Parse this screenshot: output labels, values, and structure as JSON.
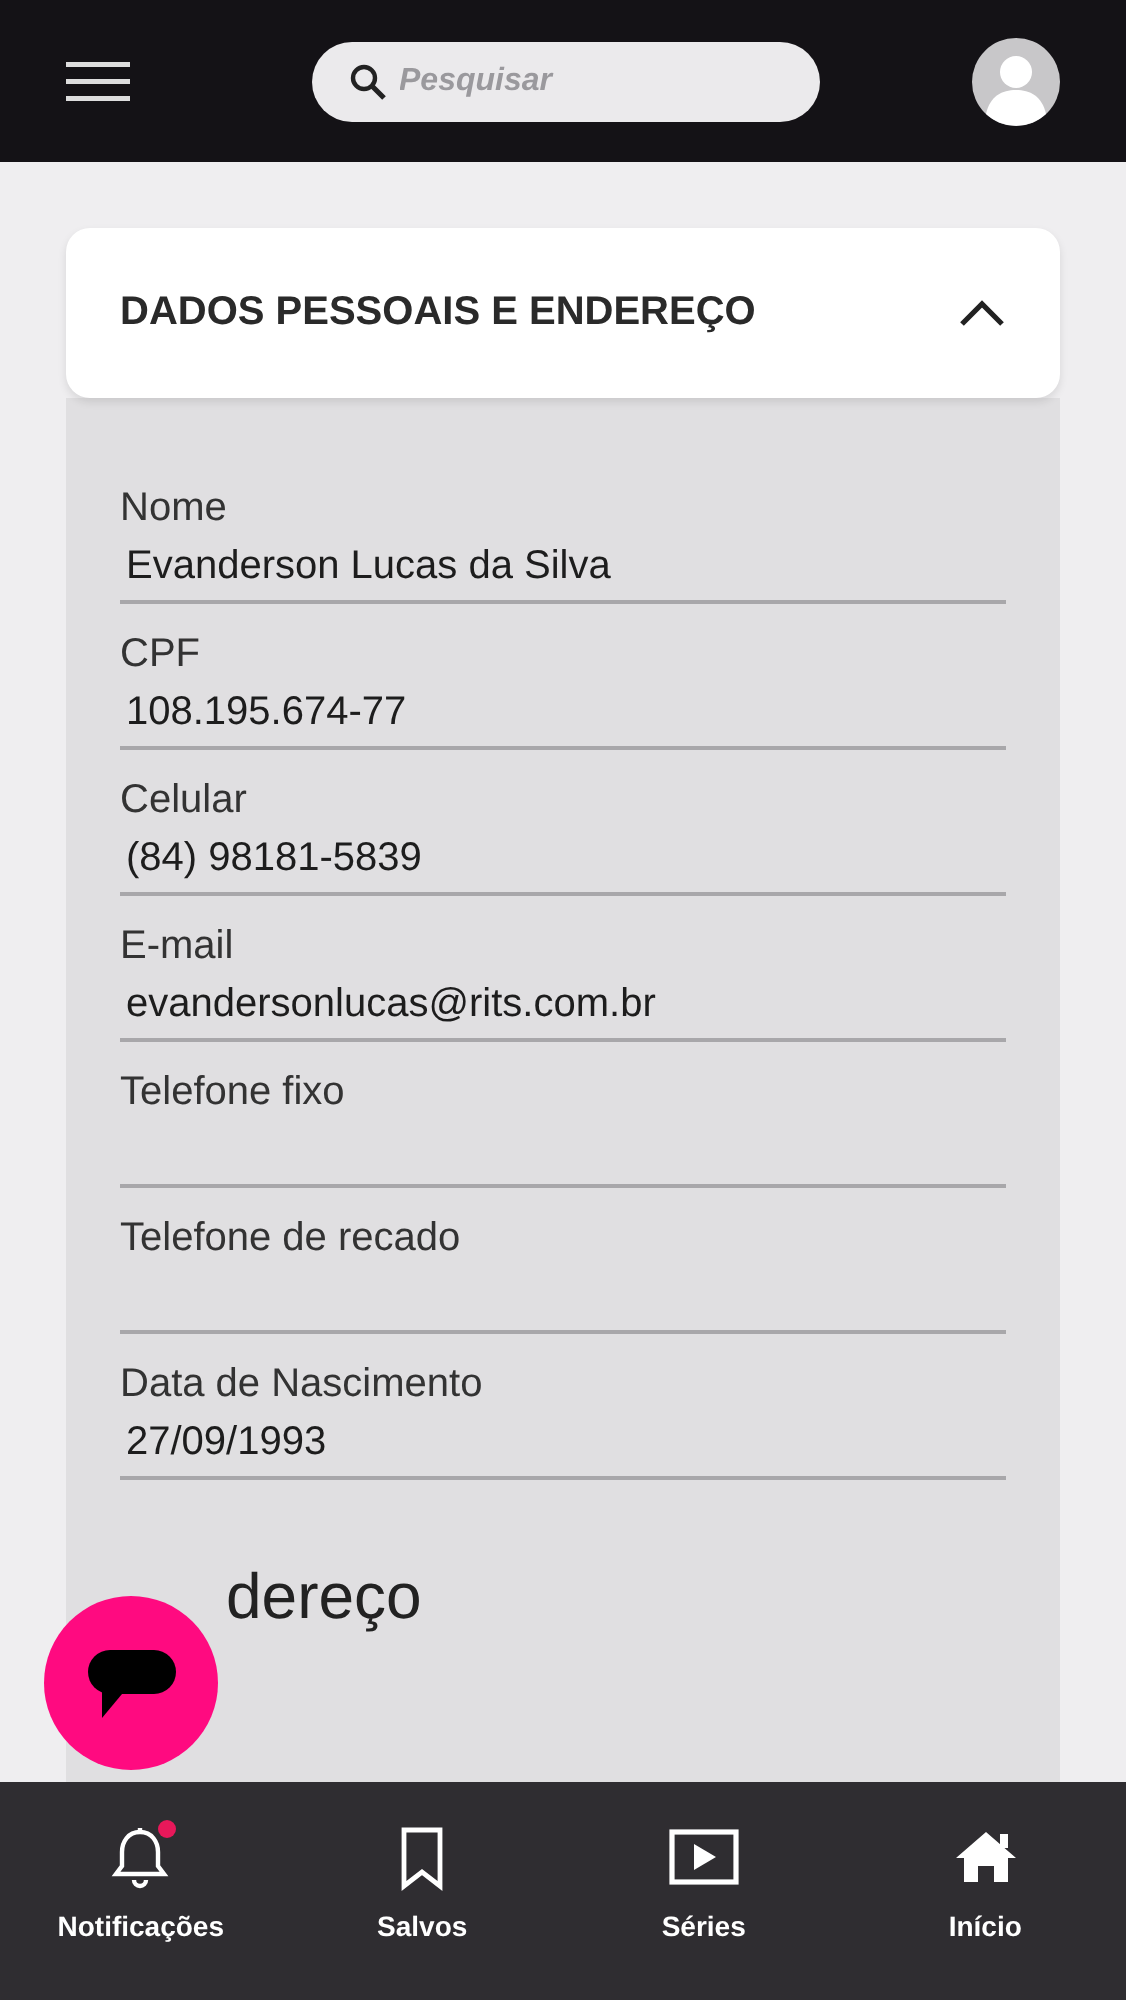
{
  "search": {
    "placeholder": "Pesquisar"
  },
  "section": {
    "title": "DADOS PESSOAIS E ENDEREÇO",
    "expanded": true
  },
  "fields": [
    {
      "label": "Nome",
      "value": "Evanderson Lucas da Silva"
    },
    {
      "label": "CPF",
      "value": "108.195.674-77"
    },
    {
      "label": "Celular",
      "value": "(84) 98181-5839"
    },
    {
      "label": "E-mail",
      "value": "evandersonlucas@rits.com.br"
    },
    {
      "label": "Telefone fixo"
    },
    {
      "label": "Telefone de recado"
    },
    {
      "label": "Data de Nascimento",
      "value": "27/09/1993"
    }
  ],
  "address_heading": "dereço",
  "nav": [
    {
      "kind": "bell",
      "label": "Notificações",
      "badge": true
    },
    {
      "kind": "bookmark",
      "label": "Salvos",
      "badge": false
    },
    {
      "kind": "play",
      "label": "Séries",
      "badge": false
    },
    {
      "kind": "home",
      "label": "Início",
      "badge": false
    }
  ]
}
